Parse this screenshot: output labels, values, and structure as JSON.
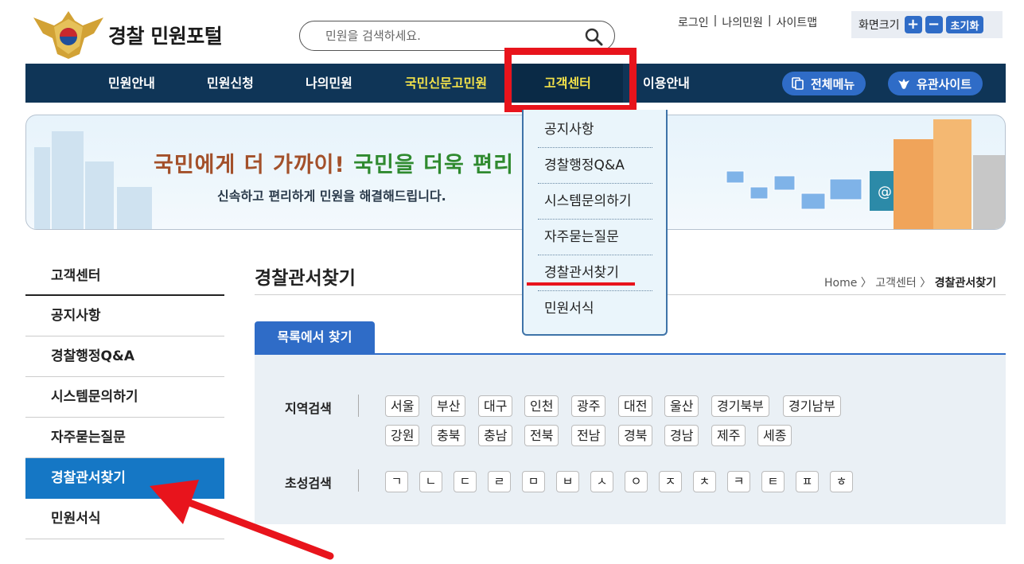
{
  "header": {
    "site_title": "경찰 민원포털",
    "search_placeholder": "민원을 검색하세요.",
    "util_links": [
      "로그인",
      "나의민원",
      "사이트맵"
    ],
    "zoom_label": "화면크기",
    "zoom_plus": "+",
    "zoom_minus": "−",
    "zoom_reset": "초기화"
  },
  "nav": {
    "items": [
      "민원안내",
      "민원신청",
      "나의민원",
      "국민신문고민원",
      "고객센터",
      "이용안내"
    ],
    "all_menu": "전체메뉴",
    "related_sites": "유관사이트"
  },
  "banner": {
    "main_part1": "국민에게 더 가까이! ",
    "main_part2": "국민을 더욱 편리",
    "sub": "신속하고 편리하게 민원을 해결해드립니다."
  },
  "dropdown": {
    "items": [
      "공지사항",
      "경찰행정Q&A",
      "시스템문의하기",
      "자주묻는질문",
      "경찰관서찾기",
      "민원서식"
    ]
  },
  "sidebar": {
    "title": "고객센터",
    "items": [
      "공지사항",
      "경찰행정Q&A",
      "시스템문의하기",
      "자주묻는질문",
      "경찰관서찾기",
      "민원서식"
    ]
  },
  "main": {
    "page_title": "경찰관서찾기",
    "breadcrumb": {
      "home": "Home",
      "sep1": " 〉",
      "level1": "고객센터",
      "sep2": " 〉",
      "current": "경찰관서찾기"
    },
    "tab": "목록에서 찾기",
    "region_label": "지역검색",
    "regions_row1": [
      "서울",
      "부산",
      "대구",
      "인천",
      "광주",
      "대전",
      "울산",
      "경기북부",
      "경기남부"
    ],
    "regions_row2": [
      "강원",
      "충북",
      "충남",
      "전북",
      "전남",
      "경북",
      "경남",
      "제주",
      "세종"
    ],
    "initial_label": "초성검색",
    "initials": [
      "ㄱ",
      "ㄴ",
      "ㄷ",
      "ㄹ",
      "ㅁ",
      "ㅂ",
      "ㅅ",
      "ㅇ",
      "ㅈ",
      "ㅊ",
      "ㅋ",
      "ㅌ",
      "ㅍ",
      "ㅎ"
    ]
  },
  "colors": {
    "nav_bg": "#0f3557",
    "accent_blue": "#2f6cc7",
    "active_side": "#1577c5",
    "highlight_yellow": "#f3e24a",
    "annotation_red": "#e8141c"
  }
}
